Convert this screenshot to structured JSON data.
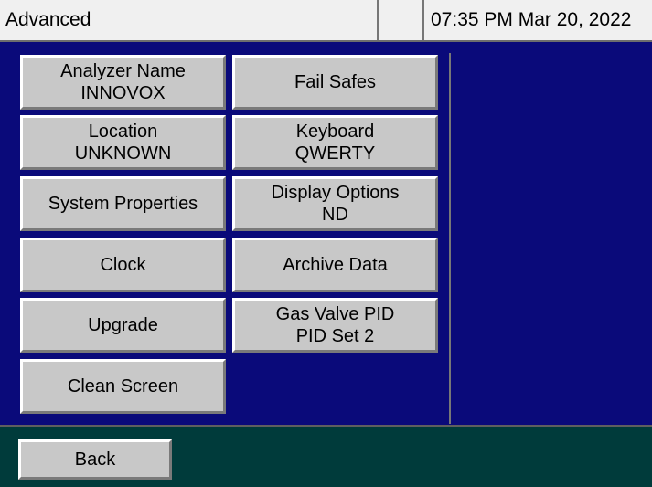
{
  "header": {
    "title": "Advanced",
    "blank": "",
    "datetime": "07:35 PM Mar 20, 2022"
  },
  "buttons": {
    "analyzer_name": {
      "label": "Analyzer Name",
      "value": "INNOVOX"
    },
    "fail_safes": {
      "label": "Fail Safes"
    },
    "location": {
      "label": "Location",
      "value": "UNKNOWN"
    },
    "keyboard": {
      "label": "Keyboard",
      "value": "QWERTY"
    },
    "system_properties": {
      "label": "System Properties"
    },
    "display_options": {
      "label": "Display Options",
      "value": "ND"
    },
    "clock": {
      "label": "Clock"
    },
    "archive_data": {
      "label": "Archive Data"
    },
    "upgrade": {
      "label": "Upgrade"
    },
    "gas_valve_pid": {
      "label": "Gas Valve PID",
      "value": "PID Set 2"
    },
    "clean_screen": {
      "label": "Clean Screen"
    }
  },
  "footer": {
    "back_label": "Back"
  },
  "colors": {
    "panel_background": "#0a0a7a",
    "footer_background": "#003b3b",
    "button_face": "#c8c8c8",
    "header_background": "#f0f0f0"
  }
}
